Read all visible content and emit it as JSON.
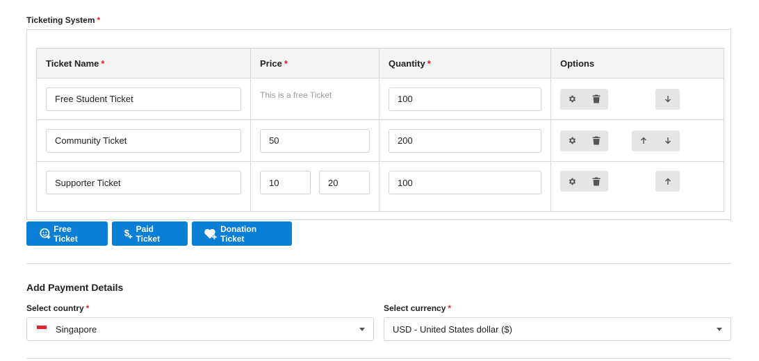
{
  "section": {
    "label": "Ticketing System",
    "required_mark": "*"
  },
  "table": {
    "headers": [
      {
        "label": "Ticket Name",
        "required": "*"
      },
      {
        "label": "Price",
        "required": "*"
      },
      {
        "label": "Quantity",
        "required": "*"
      },
      {
        "label": "Options",
        "required": ""
      }
    ],
    "rows": [
      {
        "name": "Free Student Ticket",
        "price_note": "This is a free Ticket",
        "quantity": "100"
      },
      {
        "name": "Community Ticket",
        "price": "50",
        "quantity": "200"
      },
      {
        "name": "Supporter Ticket",
        "price_min": "10",
        "price_max": "20",
        "quantity": "100"
      }
    ]
  },
  "buttons": {
    "free": "Free Ticket",
    "paid": "Paid Ticket",
    "donation": "Donation Ticket"
  },
  "payment": {
    "title": "Add Payment Details",
    "country_label": "Select country",
    "country_value": "Singapore",
    "currency_label": "Select currency",
    "currency_value": "USD - United States dollar ($)",
    "required_mark": "*"
  },
  "colors": {
    "accent": "#0a7fd5",
    "required": "#e02020",
    "flag_red": "#e4232c"
  },
  "icons": [
    "gear-icon",
    "trash-icon",
    "arrow-up-icon",
    "arrow-down-icon",
    "free-ticket-icon",
    "dollar-plus-icon",
    "heart-plus-icon",
    "caret-down-icon",
    "singapore-flag-icon"
  ]
}
